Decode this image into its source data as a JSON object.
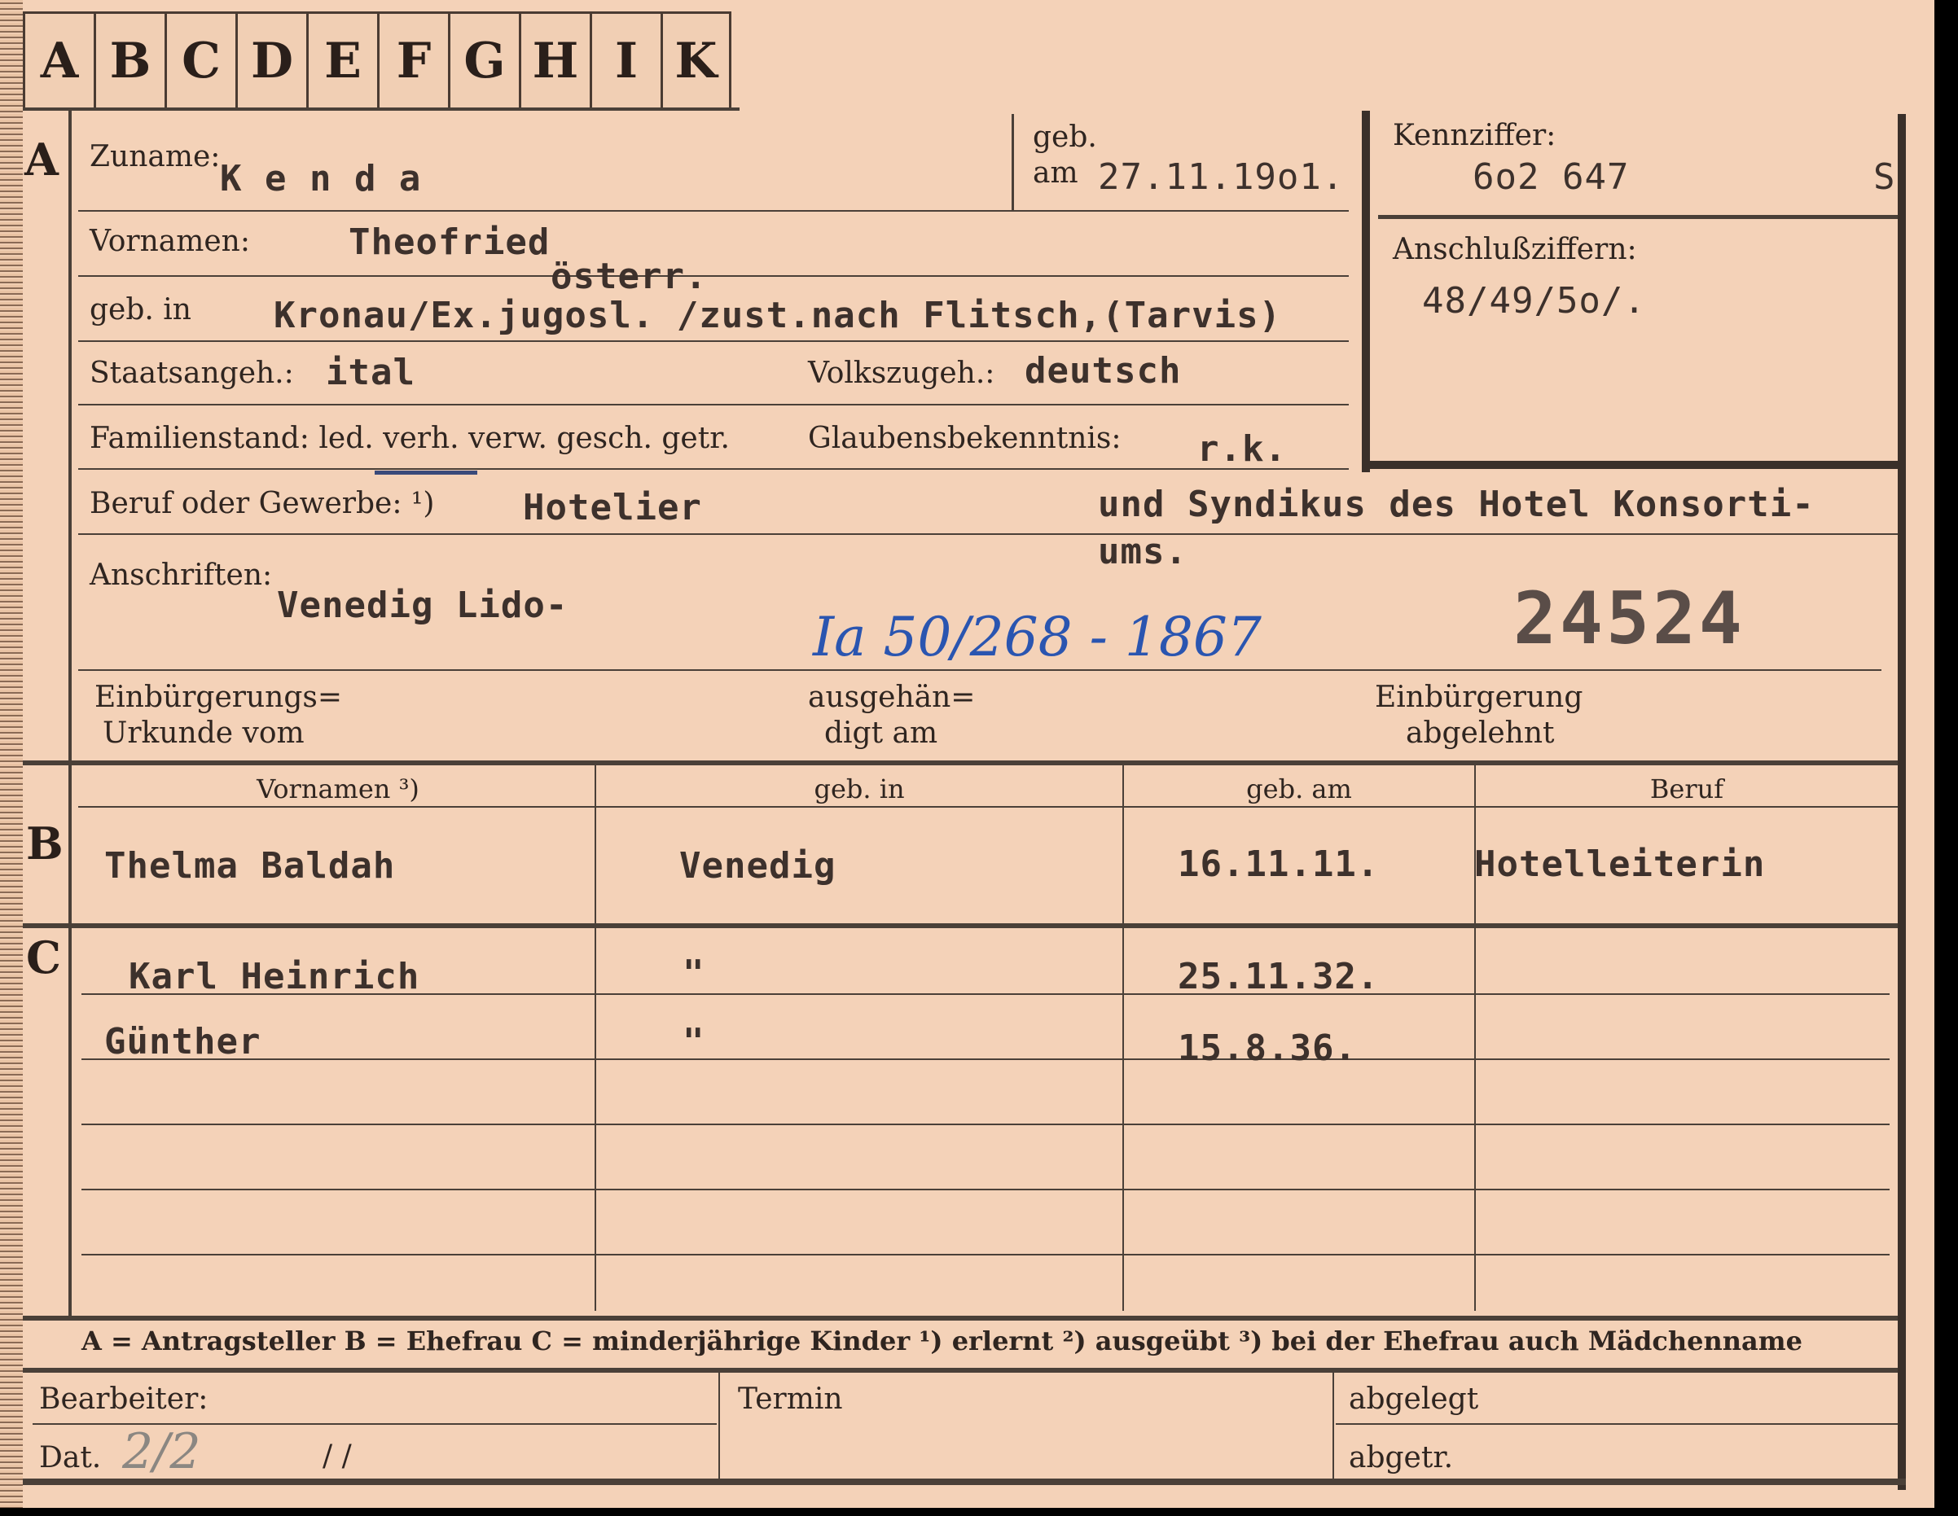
{
  "tabs": [
    "A",
    "B",
    "C",
    "D",
    "E",
    "F",
    "G",
    "H",
    "I",
    "K"
  ],
  "sections": {
    "a": "A",
    "b": "B",
    "c": "C"
  },
  "labels": {
    "zuname": "Zuname:",
    "geb": "geb.",
    "am": "am",
    "kennziffer": "Kennziffer:",
    "vornamen": "Vornamen:",
    "anschluss": "Anschlußziffern:",
    "geb_in": "geb. in",
    "staat": "Staatsangeh.:",
    "volk": "Volkszugeh.:",
    "familienstand": "Familienstand: led. verh. verw. gesch. getr.",
    "glauben": "Glaubensbekenntnis:",
    "beruf": "Beruf oder Gewerbe: ¹)",
    "anschriften": "Anschriften:",
    "einb_urkunde_1": "Einbürgerungs=",
    "einb_urkunde_2": "Urkunde vom",
    "ausgeh_1": "ausgehän=",
    "ausgeh_2": "digt am",
    "abgelehnt_1": "Einbürgerung",
    "abgelehnt_2": "abgelehnt"
  },
  "applicant": {
    "surname": "K e n d a",
    "birthdate": "27.11.19o1.",
    "kennziffer": "6o2 647",
    "kennziffer_suffix": "S",
    "firstnames": "Theofried",
    "austria_note": "österr.",
    "birthplace": "Kronau/Ex.jugosl. /zust.nach Flitsch,(Tarvis)",
    "anschluss": "48/49/5o/.",
    "citizenship": "ital",
    "ethnicity": "deutsch",
    "religion": "r.k.",
    "occupation": "Hotelier",
    "occupation_2": "und Syndikus des Hotel Konsorti-",
    "occupation_3": "ums.",
    "address": "Venedig Lido-"
  },
  "handwritten": {
    "reference": "Ia 50/268 - 1867",
    "stamp_number": "24524",
    "pencil_date": "2/2"
  },
  "table": {
    "headers": [
      "Vornamen ³)",
      "geb. in",
      "geb. am",
      "Beruf"
    ],
    "spouse": {
      "name": "Thelma Baldah",
      "birthplace": "Venedig",
      "birthdate": "16.11.11.",
      "occupation": "Hotelleiterin"
    },
    "children": [
      {
        "name": "Karl Heinrich",
        "birthplace": "\"",
        "birthdate": "25.11.32."
      },
      {
        "name": "Günther",
        "birthplace": "\"",
        "birthdate": "15.8.36."
      }
    ]
  },
  "legend": "A = Antragsteller   B = Ehefrau   C = minderjährige Kinder   ¹) erlernt   ²) ausgeübt   ³) bei der Ehefrau auch Mädchenname",
  "footer": {
    "bearbeiter": "Bearbeiter:",
    "dat": "Dat.",
    "slashes": "/                /",
    "termin": "Termin",
    "abgelegt": "abgelegt",
    "abgetr": "abgetr."
  }
}
